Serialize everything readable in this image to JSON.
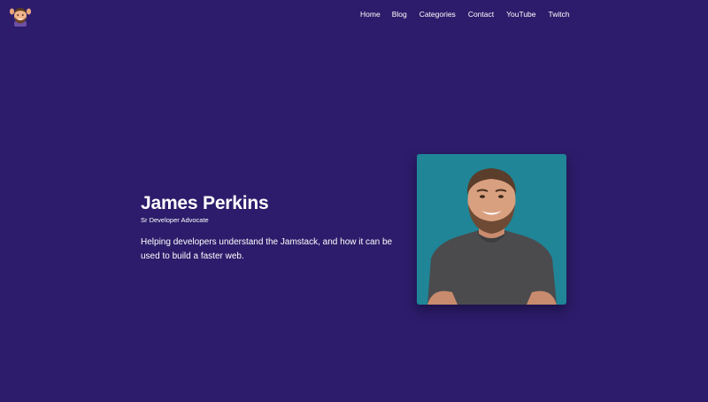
{
  "brand": {
    "logo_icon": "memoji-avatar-icon"
  },
  "nav": {
    "items": [
      {
        "label": "Home"
      },
      {
        "label": "Blog"
      },
      {
        "label": "Categories"
      },
      {
        "label": "Contact"
      },
      {
        "label": "YouTube"
      },
      {
        "label": "Twitch"
      }
    ]
  },
  "hero": {
    "name": "James Perkins",
    "role": "Sr Developer Advocate",
    "tagline": "Helping developers understand the Jamstack, and how it can be used to build a faster web.",
    "photo_icon": "profile-photo-icon"
  },
  "colors": {
    "background": "#2c1c6b",
    "photo_background": "#1f8597",
    "text": "#ffffff"
  }
}
